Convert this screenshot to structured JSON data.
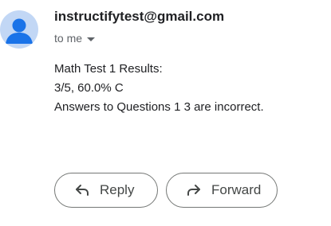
{
  "message": {
    "sender": "instructifytest@gmail.com",
    "recipient_label": "to me",
    "recipient_icon": "chevron-down-icon",
    "body_lines": [
      "Math Test 1 Results:",
      "3/5, 60.0% C",
      "Answers to Questions 1 3 are incorrect."
    ]
  },
  "actions": {
    "reply_label": "Reply",
    "reply_icon": "reply-icon",
    "forward_label": "Forward",
    "forward_icon": "forward-icon"
  },
  "colors": {
    "avatar_bg": "#c2d7f5",
    "avatar_fg": "#1a73e8",
    "button_border": "#747775"
  }
}
